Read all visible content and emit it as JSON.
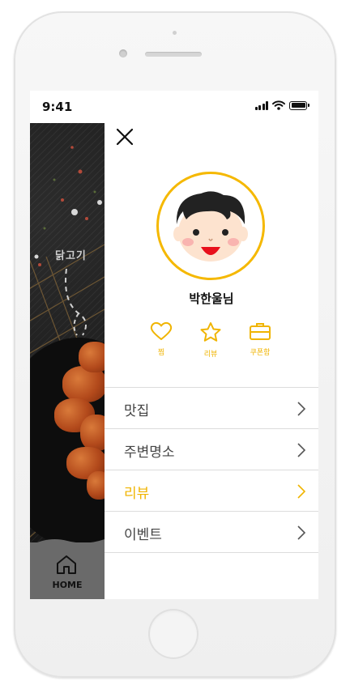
{
  "status_bar": {
    "time": "9:41"
  },
  "background": {
    "label": "닭고기"
  },
  "home_tab": {
    "label": "HOME"
  },
  "profile": {
    "name": "박한울님"
  },
  "quick_actions": [
    {
      "label": "찜",
      "icon": "heart-icon"
    },
    {
      "label": "리뷰",
      "icon": "star-icon"
    },
    {
      "label": "쿠폰함",
      "icon": "briefcase-icon"
    }
  ],
  "menu": [
    {
      "label": "맛집",
      "active": false
    },
    {
      "label": "주변명소",
      "active": false
    },
    {
      "label": "리뷰",
      "active": true
    },
    {
      "label": "이벤트",
      "active": false
    }
  ],
  "colors": {
    "accent": "#f0b400",
    "avatar_border": "#f5b800",
    "tab_bg": "#6a6a6a"
  }
}
